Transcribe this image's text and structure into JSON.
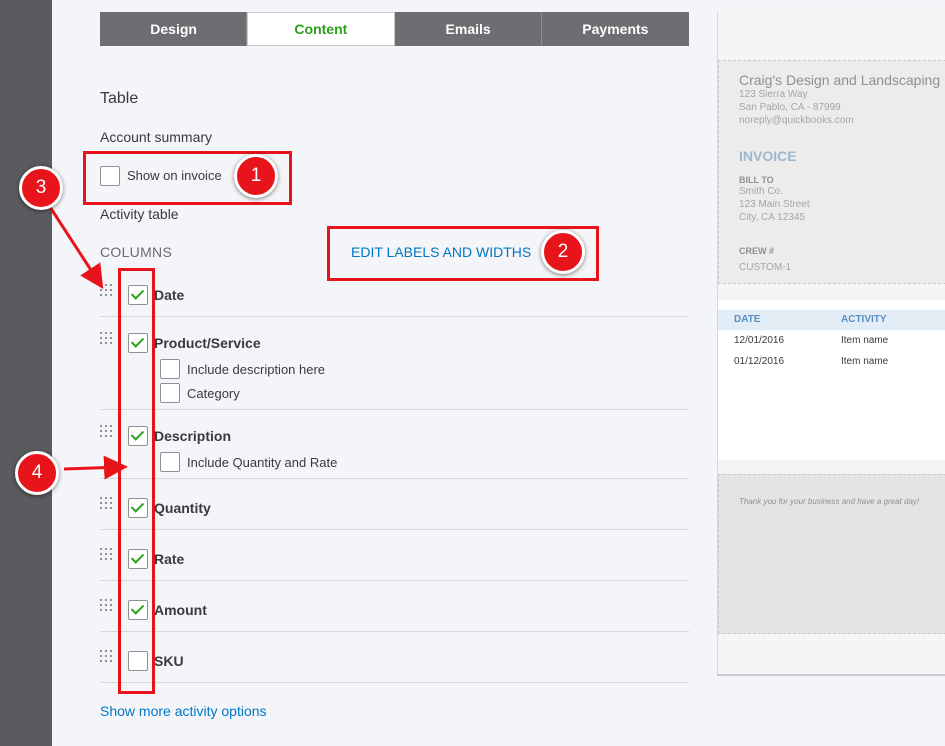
{
  "tabs": [
    {
      "label": "Design",
      "active": false
    },
    {
      "label": "Content",
      "active": true
    },
    {
      "label": "Emails",
      "active": false
    },
    {
      "label": "Payments",
      "active": false
    }
  ],
  "section": {
    "title": "Table",
    "account_summary_label": "Account summary",
    "show_on_invoice_label": "Show on invoice",
    "show_on_invoice_checked": false,
    "activity_table_label": "Activity table",
    "columns_label": "COLUMNS",
    "edit_link": "EDIT LABELS AND WIDTHS",
    "more_link": "Show more activity options"
  },
  "columns": [
    {
      "name": "Date",
      "checked": true
    },
    {
      "name": "Product/Service",
      "checked": true,
      "options": [
        {
          "label": "Include description here",
          "checked": false
        },
        {
          "label": "Category",
          "checked": false
        }
      ]
    },
    {
      "name": "Description",
      "checked": true,
      "options": [
        {
          "label": "Include Quantity and Rate",
          "checked": false
        }
      ]
    },
    {
      "name": "Quantity",
      "checked": true
    },
    {
      "name": "Rate",
      "checked": true
    },
    {
      "name": "Amount",
      "checked": true
    },
    {
      "name": "SKU",
      "checked": false
    }
  ],
  "annotations": [
    "1",
    "2",
    "3",
    "4"
  ],
  "preview": {
    "company": "Craig's Design and Landscaping",
    "address_line1": "123 Sierra Way",
    "address_line2": "San Pablo, CA - 87999",
    "email": "noreply@quickbooks.com",
    "invoice_title": "INVOICE",
    "bill_to_label": "BILL TO",
    "bill_to_name": "Smith Co.",
    "bill_to_street": "123 Main Street",
    "bill_to_city": "City, CA 12345",
    "crew_label": "CREW #",
    "custom_field": "CUSTOM-1",
    "table_headers": [
      "DATE",
      "ACTIVITY"
    ],
    "table_rows": [
      [
        "12/01/2016",
        "Item name"
      ],
      [
        "01/12/2016",
        "Item name"
      ]
    ],
    "thanks": "Thank you for your business and have a great day!"
  },
  "colors": {
    "accent_green": "#2ca01c",
    "link_blue": "#0077c5",
    "annotation_red": "#e8141b"
  }
}
